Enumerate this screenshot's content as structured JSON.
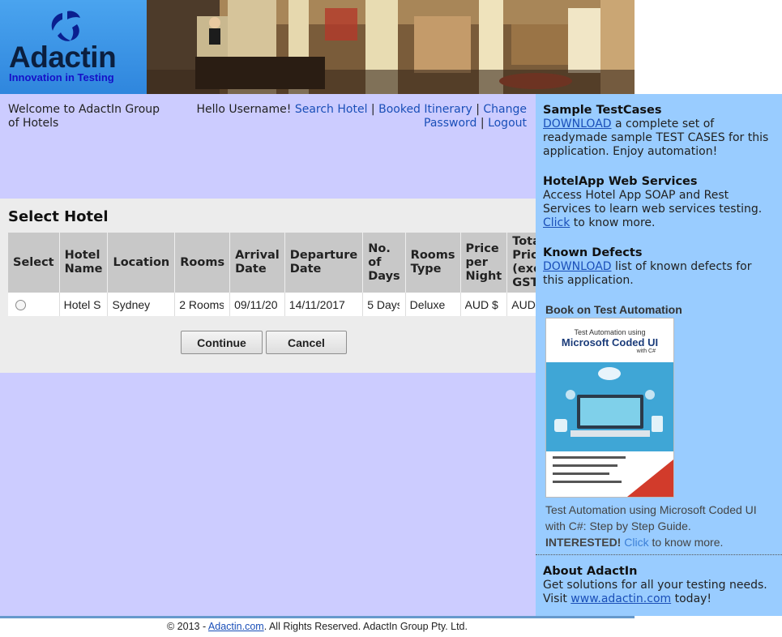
{
  "logo": {
    "word": "Adactin",
    "tagline": "Innovation in Testing"
  },
  "welcome": "Welcome to AdactIn Group of Hotels",
  "user_nav": {
    "greeting": "Hello Username!",
    "search_hotel": "Search Hotel",
    "booked_itinerary": "Booked Itinerary",
    "change_password": "Change Password",
    "logout": "Logout",
    "separator": "|"
  },
  "panel": {
    "title": "Select Hotel",
    "columns": [
      "Select",
      "Hotel Name",
      "Location",
      "Rooms",
      "Arrival Date",
      "Departure Date",
      "No. of Days",
      "Rooms Type",
      "Price per Night",
      "Total Price (excl. GST)"
    ],
    "rows": [
      {
        "hotel": "Hotel S",
        "location": "Sydney",
        "rooms": "2 Rooms",
        "arrival": "09/11/20",
        "departure": "14/11/2017",
        "days": "5 Days",
        "room_type": "Deluxe",
        "price": "AUD $",
        "total": "AUD $"
      }
    ],
    "continue_label": "Continue",
    "cancel_label": "Cancel"
  },
  "sidebar": {
    "testcases": {
      "title": "Sample TestCases",
      "link": "DOWNLOAD",
      "text": " a complete set of readymade sample TEST CASES for this application. Enjoy automation!"
    },
    "webservices": {
      "title": "HotelApp Web Services",
      "text": "Access Hotel App SOAP and Rest Services to learn web services testing.",
      "link": "Click",
      "text2": " to know more."
    },
    "defects": {
      "title": "Known Defects",
      "link": "DOWNLOAD",
      "text": " list of known defects for this application."
    },
    "book": {
      "heading": "Book on Test Automation",
      "cover_line1": "Test Automation using",
      "cover_line2": "Microsoft Coded UI",
      "cover_line3": "with C#",
      "desc": "Test Automation using Microsoft Coded UI with C#: Step by Step Guide.",
      "interested": "INTERESTED!",
      "link": "Click",
      "tail": " to know more."
    },
    "about": {
      "title": "About AdactIn",
      "text": "Get solutions for all your testing needs. Visit ",
      "link": "www.adactin.com",
      "text2": " today!"
    }
  },
  "footer": {
    "prefix": "© 2013 - ",
    "link": "Adactin.com",
    "suffix": ". All Rights Reserved. AdactIn Group Pty. Ltd."
  },
  "colors": {
    "left_bg": "#ccccff",
    "right_bg": "#99ccff",
    "panel_bg": "#ececec",
    "link": "#1a4fb8"
  }
}
